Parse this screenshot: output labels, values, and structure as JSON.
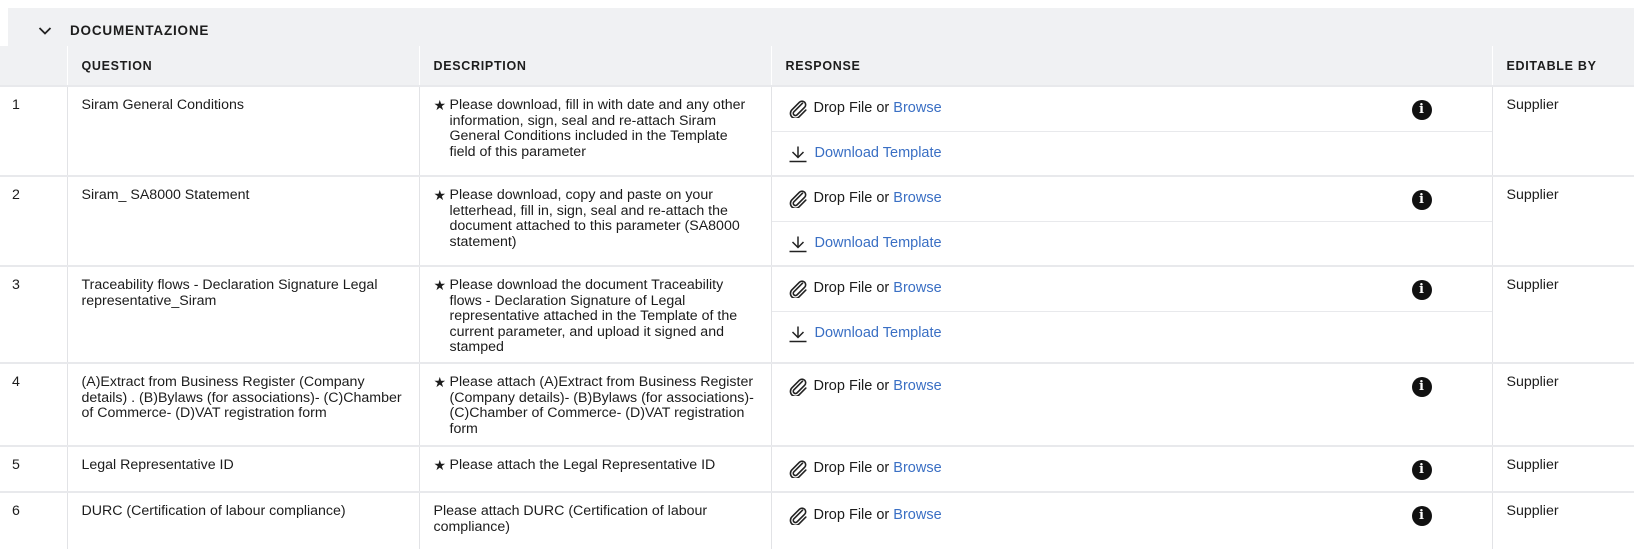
{
  "section": {
    "title": "DOCUMENTAZIONE",
    "icon": "chevron-down-icon"
  },
  "columns": {
    "question": "QUESTION",
    "description": "DESCRIPTION",
    "response": "RESPONSE",
    "editable_by": "EDITABLE BY"
  },
  "response_ui": {
    "drop_text": "Drop File or ",
    "browse": "Browse",
    "download_template": "Download Template",
    "info_icon": "info-icon",
    "attach_icon": "paperclip-icon",
    "download_icon": "download-icon"
  },
  "rows": [
    {
      "num": "1",
      "question": "Siram General Conditions",
      "desc_star": "★",
      "description": "Please download, fill in with date and any other information, sign, seal and re-attach Siram General Conditions included in the Template field of this parameter",
      "editable_by": "Supplier"
    },
    {
      "num": "2",
      "question": "Siram_ SA8000 Statement",
      "desc_star": "★",
      "description": "Please download, copy and paste on your letterhead, fill in, sign, seal and re-attach the document attached to this parameter (SA8000 statement)",
      "editable_by": "Supplier"
    },
    {
      "num": "3",
      "question": "Traceability flows - Declaration Signature Legal representative_Siram",
      "desc_star": "★",
      "description": "Please download the document Traceability flows - Declaration Signature of Legal representative attached in the Template of the current parameter, and upload it signed and stamped",
      "editable_by": "Supplier"
    },
    {
      "num": "4",
      "question": "(A)Extract from Business Register (Company details) . (B)Bylaws (for associations)- (C)Chamber of Commerce- (D)VAT registration form",
      "desc_star": "★",
      "description": "Please attach (A)Extract from Business Register (Company details)- (B)Bylaws (for associations)- (C)Chamber of Commerce- (D)VAT registration form",
      "editable_by": "Supplier"
    },
    {
      "num": "5",
      "question": "Legal Representative ID",
      "desc_star": "★",
      "description": "Please attach the Legal Representative ID",
      "editable_by": "Supplier"
    },
    {
      "num": "6",
      "question": "DURC (Certification of labour compliance)",
      "desc_star": "",
      "description": "Please attach DURC (Certification of labour compliance)",
      "editable_by": "Supplier"
    }
  ]
}
